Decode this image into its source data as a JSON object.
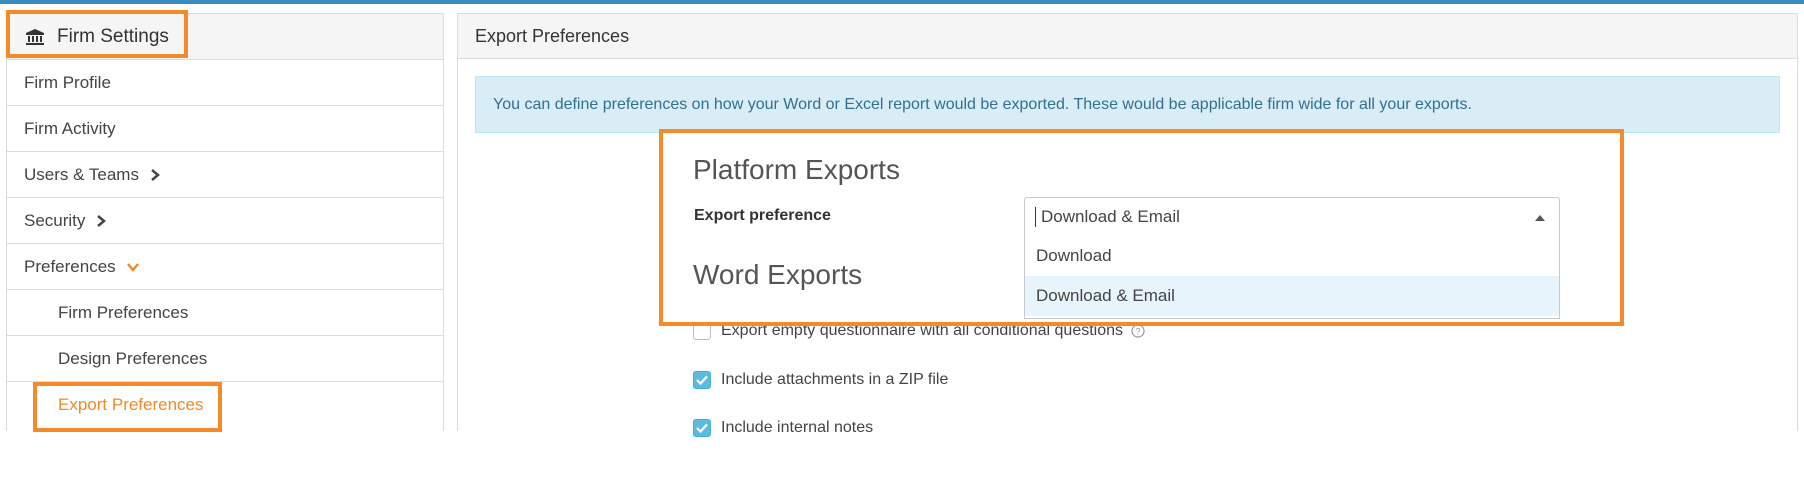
{
  "sidebar": {
    "title": "Firm Settings",
    "items": [
      {
        "label": "Firm Profile"
      },
      {
        "label": "Firm Activity"
      },
      {
        "label": "Users & Teams"
      },
      {
        "label": "Security"
      },
      {
        "label": "Preferences"
      },
      {
        "label": "Firm Preferences"
      },
      {
        "label": "Design Preferences"
      },
      {
        "label": "Export Preferences"
      }
    ]
  },
  "main": {
    "title": "Export Preferences",
    "info": "You can define preferences on how your Word or Excel report would be exported. These would be applicable firm wide for all your exports.",
    "platform_exports": {
      "title": "Platform Exports",
      "label": "Export preference",
      "selected": "Download & Email",
      "options": [
        "Download",
        "Download & Email"
      ]
    },
    "word_exports": {
      "title": "Word Exports",
      "checks": [
        {
          "label": "Export empty questionnaire with all conditional questions",
          "checked": false
        },
        {
          "label": "Include attachments in a ZIP file",
          "checked": true
        },
        {
          "label": "Include internal notes",
          "checked": true
        }
      ]
    }
  },
  "colors": {
    "accent": "#f08a24",
    "highlight": "#f58a2b",
    "info_bg": "#d9edf7",
    "checkbox": "#5bbcdd"
  }
}
